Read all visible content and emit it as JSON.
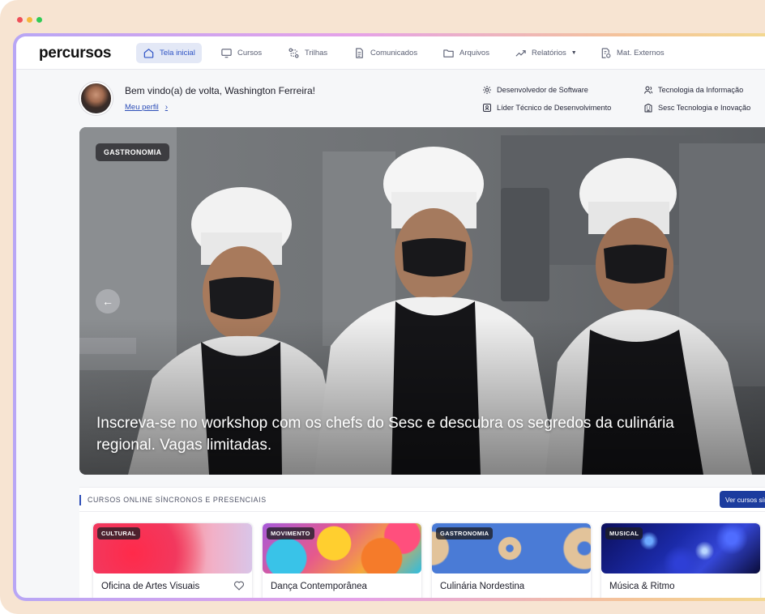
{
  "app": {
    "logo": "percursos"
  },
  "nav": {
    "items": [
      {
        "label": "Tela inicial",
        "icon": "home-icon",
        "active": true
      },
      {
        "label": "Cursos",
        "icon": "monitor-icon"
      },
      {
        "label": "Trilhas",
        "icon": "route-icon"
      },
      {
        "label": "Comunicados",
        "icon": "document-icon"
      },
      {
        "label": "Arquivos",
        "icon": "folder-icon"
      },
      {
        "label": "Relatórios",
        "icon": "trend-icon",
        "dropdown": true
      },
      {
        "label": "Mat. Externos",
        "icon": "external-doc-icon"
      }
    ]
  },
  "user": {
    "welcome": "Bem vindo(a) de volta, Washington Ferreira!",
    "profile_link": "Meu perfil",
    "profile_chevron": "›",
    "role": "Desenvolvedor de Software",
    "position": "Líder Técnico de Desenvolvimento",
    "department": "Tecnologia da Informação",
    "organization": "Sesc Tecnologia e Inovação"
  },
  "hero": {
    "tag": "GASTRONOMIA",
    "caption": "Inscreva-se no workshop com os chefs do Sesc e descubra os segredos da culinária regional. Vagas limitadas.",
    "prev_arrow": "←"
  },
  "section": {
    "title": "CURSOS ONLINE SÍNCRONOS E PRESENCIAIS",
    "button": "Ver cursos síncronos"
  },
  "cards": [
    {
      "tag": "CULTURAL",
      "title": "Oficina de Artes Visuais"
    },
    {
      "tag": "MOVIMENTO",
      "title": "Dança Contemporânea"
    },
    {
      "tag": "GASTRONOMIA",
      "title": "Culinária Nordestina"
    },
    {
      "tag": "MUSICAL",
      "title": "Música & Ritmo"
    }
  ],
  "colors": {
    "accent": "#2e4fb8",
    "button": "#1c3c9e",
    "active_nav_bg": "#e3e8f6"
  }
}
